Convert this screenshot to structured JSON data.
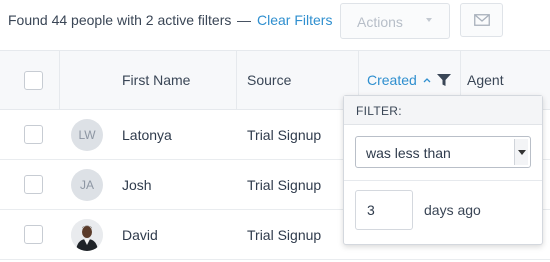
{
  "toolbar": {
    "found_text": "Found 44 people with 2 active filters",
    "separator": "—",
    "clear_filters": "Clear Filters",
    "actions_label": "Actions"
  },
  "columns": {
    "first_name": "First Name",
    "source": "Source",
    "created": "Created",
    "agent": "Agent"
  },
  "rows": [
    {
      "initials": "LW",
      "first_name": "Latonya",
      "source": "Trial Signup",
      "avatar": "initials"
    },
    {
      "initials": "JA",
      "first_name": "Josh",
      "source": "Trial Signup",
      "avatar": "initials"
    },
    {
      "initials": "",
      "first_name": "David",
      "source": "Trial Signup",
      "avatar": "photo"
    }
  ],
  "filter_popover": {
    "title": "FILTER:",
    "condition": "was less than",
    "value": "3",
    "unit": "days ago"
  },
  "colors": {
    "accent": "#2f8fcf",
    "header_bg": "#f7f8fa",
    "border": "#e6e9ed"
  }
}
